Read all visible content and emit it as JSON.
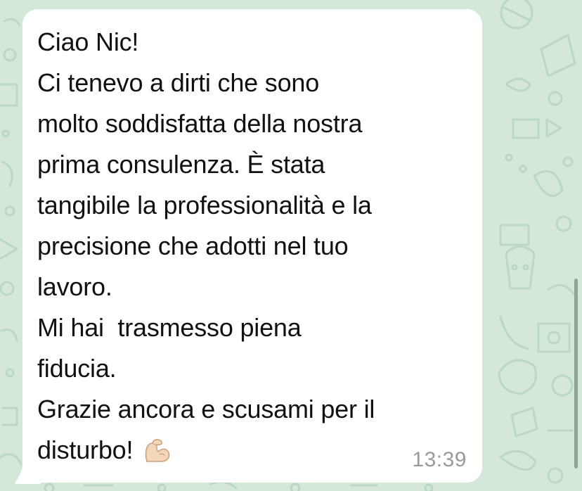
{
  "chat": {
    "wallpaper_color": "#d3e8d9",
    "wallpaper_doodle_color": "#bcd7c3",
    "bubble_color": "#ffffff",
    "message": {
      "lines": [
        "Ciao Nic!",
        "Ci tenevo a dirti che sono",
        "molto soddisfatta della nostra",
        "prima consulenza. È stata",
        "tangibile la professionalità e la",
        "precisione che adotti nel tuo",
        "lavoro.",
        "Mi hai  trasmesso piena",
        "fiducia.",
        "Grazie ancora e scusami per il",
        "disturbo!"
      ],
      "emoji": "flexed-biceps-icon",
      "time": "13:39"
    }
  }
}
